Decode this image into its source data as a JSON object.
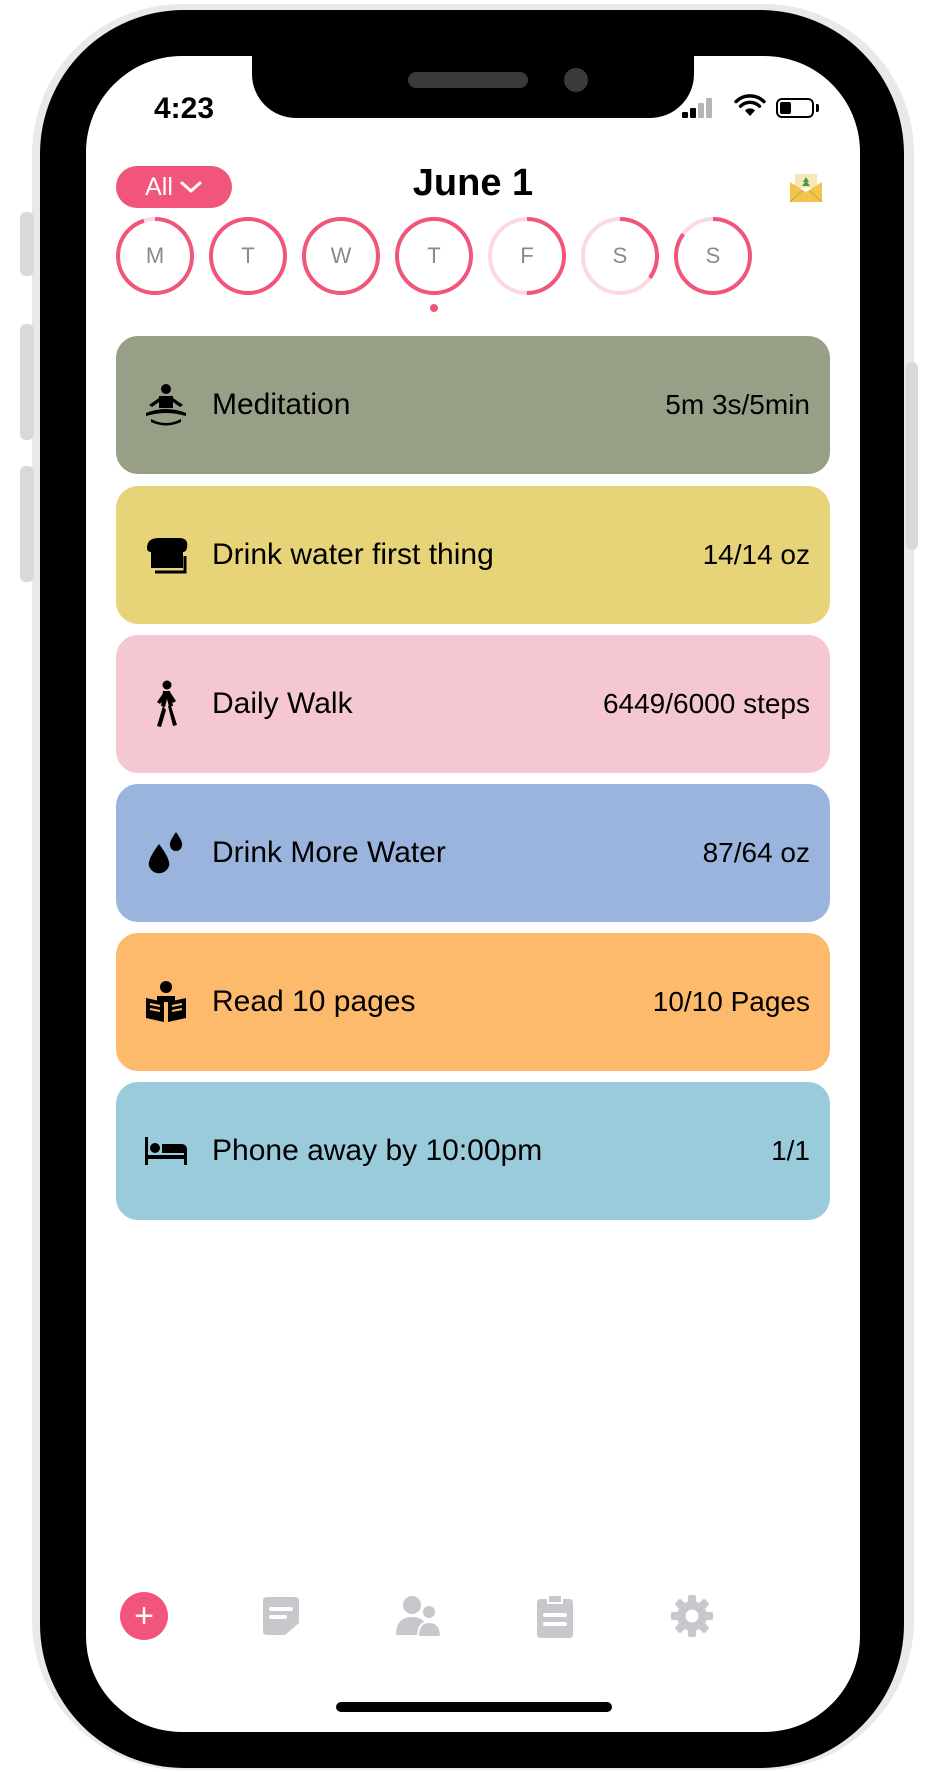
{
  "status_bar": {
    "time": "4:23"
  },
  "header": {
    "filter_label": "All",
    "title": "June 1"
  },
  "week": {
    "days": [
      {
        "label": "M",
        "progress": 0.95,
        "today": false
      },
      {
        "label": "T",
        "progress": 1.0,
        "today": false
      },
      {
        "label": "W",
        "progress": 1.0,
        "today": false
      },
      {
        "label": "T",
        "progress": 1.0,
        "today": true
      },
      {
        "label": "F",
        "progress": 0.5,
        "today": false
      },
      {
        "label": "S",
        "progress": 0.35,
        "today": false
      },
      {
        "label": "S",
        "progress": 0.85,
        "today": false
      }
    ]
  },
  "habits": [
    {
      "name": "Meditation",
      "progress": "5m 3s/5min",
      "icon": "meditation-icon",
      "color": "#979f86"
    },
    {
      "name": "Drink water first thing",
      "progress": "14/14 oz",
      "icon": "toast-icon",
      "color": "#e8d478"
    },
    {
      "name": "Daily Walk",
      "progress": "6449/6000 steps",
      "icon": "walking-icon",
      "color": "#f4c7d1"
    },
    {
      "name": "Drink More Water",
      "progress": "87/64 oz",
      "icon": "water-drops-icon",
      "color": "#9bb4dd"
    },
    {
      "name": "Read 10 pages",
      "progress": "10/10 Pages",
      "icon": "reading-icon",
      "color": "#fdb96c"
    },
    {
      "name": "Phone away by 10:00pm",
      "progress": "1/1",
      "icon": "bed-icon",
      "color": "#99cbdb"
    }
  ],
  "tabbar": {
    "items": [
      {
        "icon": "add-icon",
        "label": "+"
      },
      {
        "icon": "notes-icon"
      },
      {
        "icon": "people-icon"
      },
      {
        "icon": "clipboard-icon"
      },
      {
        "icon": "gear-icon"
      }
    ]
  },
  "colors": {
    "accent": "#f2557a",
    "ring_track": "#fbd9e1",
    "inactive_icon": "#c7c7cc"
  }
}
